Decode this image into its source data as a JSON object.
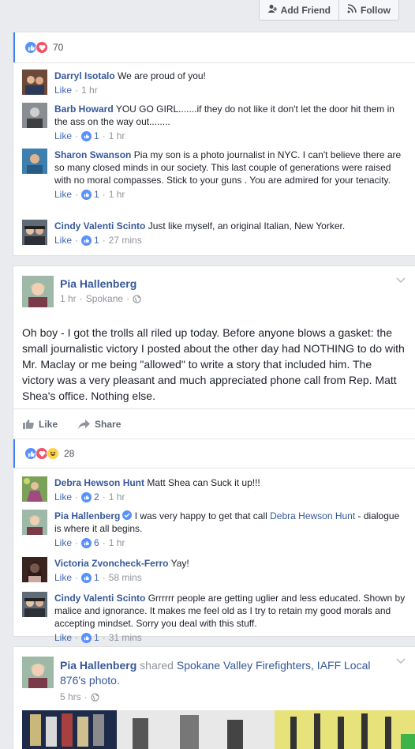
{
  "header": {
    "add_friend": "Add Friend",
    "follow": "Follow"
  },
  "post1": {
    "reaction_count": "70",
    "comments": [
      {
        "author": "Darryl Isotalo",
        "text": "We are proud of you!",
        "like": "Like",
        "likes": "",
        "time": "1 hr"
      },
      {
        "author": "Barb Howard",
        "text": "YOU GO GIRL.......if they do not like it don't let the door hit them in the ass on the way out........",
        "like": "Like",
        "likes": "1",
        "time": "1 hr"
      },
      {
        "author": "Sharon Swanson",
        "text": "Pia my son is a photo journalist in NYC. I can't believe there are so many closed minds in our society. This last couple of generations were raised with no moral compasses. Stick to your guns . You are admired for your tenacity.",
        "like": "Like",
        "likes": "1",
        "time": "1 hr"
      },
      {
        "author": "Cindy Valenti Scinto",
        "text": "Just like myself, an original Italian, New Yorker.",
        "like": "Like",
        "likes": "1",
        "time": "27 mins"
      }
    ]
  },
  "post2": {
    "author": "Pia Hallenberg",
    "time": "1 hr",
    "location": "Spokane",
    "text": "Oh boy - I got the trolls all riled up today. Before anyone blows a gasket: the small journalistic victory I posted about the other day had NOTHING to do with Mr. Maclay or me being \"allowed\" to write a story that included him. The victory was a very pleasant and much appreciated phone call from Rep. Matt Shea's office. Nothing else.",
    "like": "Like",
    "share": "Share",
    "reaction_count": "28",
    "comments": [
      {
        "author": "Debra Hewson Hunt",
        "text": "Matt Shea can Suck it up!!!",
        "like": "Like",
        "likes": "2",
        "time": "1 hr"
      },
      {
        "author": "Pia Hallenberg",
        "text": "I was very happy to get that call ",
        "mention": "Debra Hewson Hunt",
        "text2": " - dialogue is where it all begins.",
        "like": "Like",
        "likes": "6",
        "time": "1 hr"
      },
      {
        "author": "Victoria Zvoncheck-Ferro",
        "text": "Yay!",
        "like": "Like",
        "likes": "1",
        "time": "58 mins"
      },
      {
        "author": "Cindy Valenti Scinto",
        "text": "Grrrrrr people are getting uglier and less educated. Shown by malice and ignorance. It makes me feel old as I try to retain my good morals and accepting mindset. Sorry you deal with this stuff.",
        "like": "Like",
        "likes": "1",
        "time": "31 mins"
      }
    ]
  },
  "post3": {
    "author": "Pia Hallenberg",
    "shared": "shared",
    "page": "Spokane Valley Firefighters, IAFF Local 876",
    "suffix": "'s photo.",
    "time": "5 hrs"
  },
  "icons": [
    "add-friend-icon",
    "rss-icon",
    "like-reaction-icon",
    "love-reaction-icon",
    "haha-reaction-icon",
    "globe-icon",
    "chevron-down-icon",
    "thumbs-up-icon",
    "share-arrow-icon",
    "verified-badge-icon"
  ],
  "colors": {
    "link": "#365899",
    "accent": "#4080ff",
    "like_blue": "#5890ff",
    "love_red": "#f25268"
  }
}
